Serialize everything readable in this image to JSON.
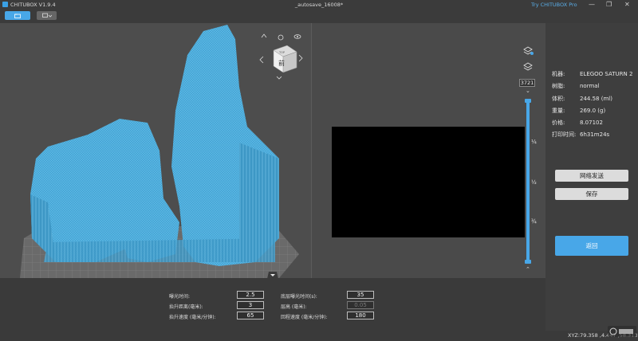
{
  "titlebar": {
    "app_title": "CHITUBOX V1.9.4",
    "doc_title": "_autosave_16008*",
    "try_pro": "Try CHITUBOX Pro",
    "minimize": "—",
    "restore": "❐",
    "close": "✕"
  },
  "toolbar": {
    "btn1_icon": "folder-icon",
    "btn2_icon": "settings-icon"
  },
  "viewport": {
    "view_cube_label": "前",
    "view_cube_top": "TOP",
    "model_color": "#4aa8d8"
  },
  "slice": {
    "layer_count": "3721",
    "ticks": [
      "¼",
      "½",
      "¾"
    ],
    "preview_color": "#000000"
  },
  "info": {
    "machine_label": "机器:",
    "machine_value": "ELEGOO SATURN 2",
    "resin_label": "树脂:",
    "resin_value": "normal",
    "volume_label": "体积:",
    "volume_value": "244.58  (ml)",
    "weight_label": "重量:",
    "weight_value": "269.0  (g)",
    "price_label": "价格:",
    "price_value": "8.07102",
    "time_label": "打印时间:",
    "time_value": "6h31m24s"
  },
  "buttons": {
    "network_send": "网络发送",
    "save": "保存",
    "back": "返回"
  },
  "params": {
    "exposure_label": "曝光时间:",
    "exposure_value": "2.5",
    "lift_dist_label": "抬升距离(毫米):",
    "lift_dist_value": "3",
    "lift_speed_label": "抬升速度 (毫米/分钟):",
    "lift_speed_value": "65",
    "bottom_exposure_label": "底层曝光时间(s):",
    "bottom_exposure_value": "35",
    "layer_height_label": "层高 (毫米):",
    "layer_height_value": "0.05",
    "retract_speed_label": "回程速度 (毫米/分钟):",
    "retract_speed_value": "180"
  },
  "status": {
    "coords": "XYZ:79.358 ,4.447 ,58.313"
  },
  "colors": {
    "accent": "#48a7e8",
    "background": "#4a4a4a",
    "panel": "#3e3e3e"
  }
}
